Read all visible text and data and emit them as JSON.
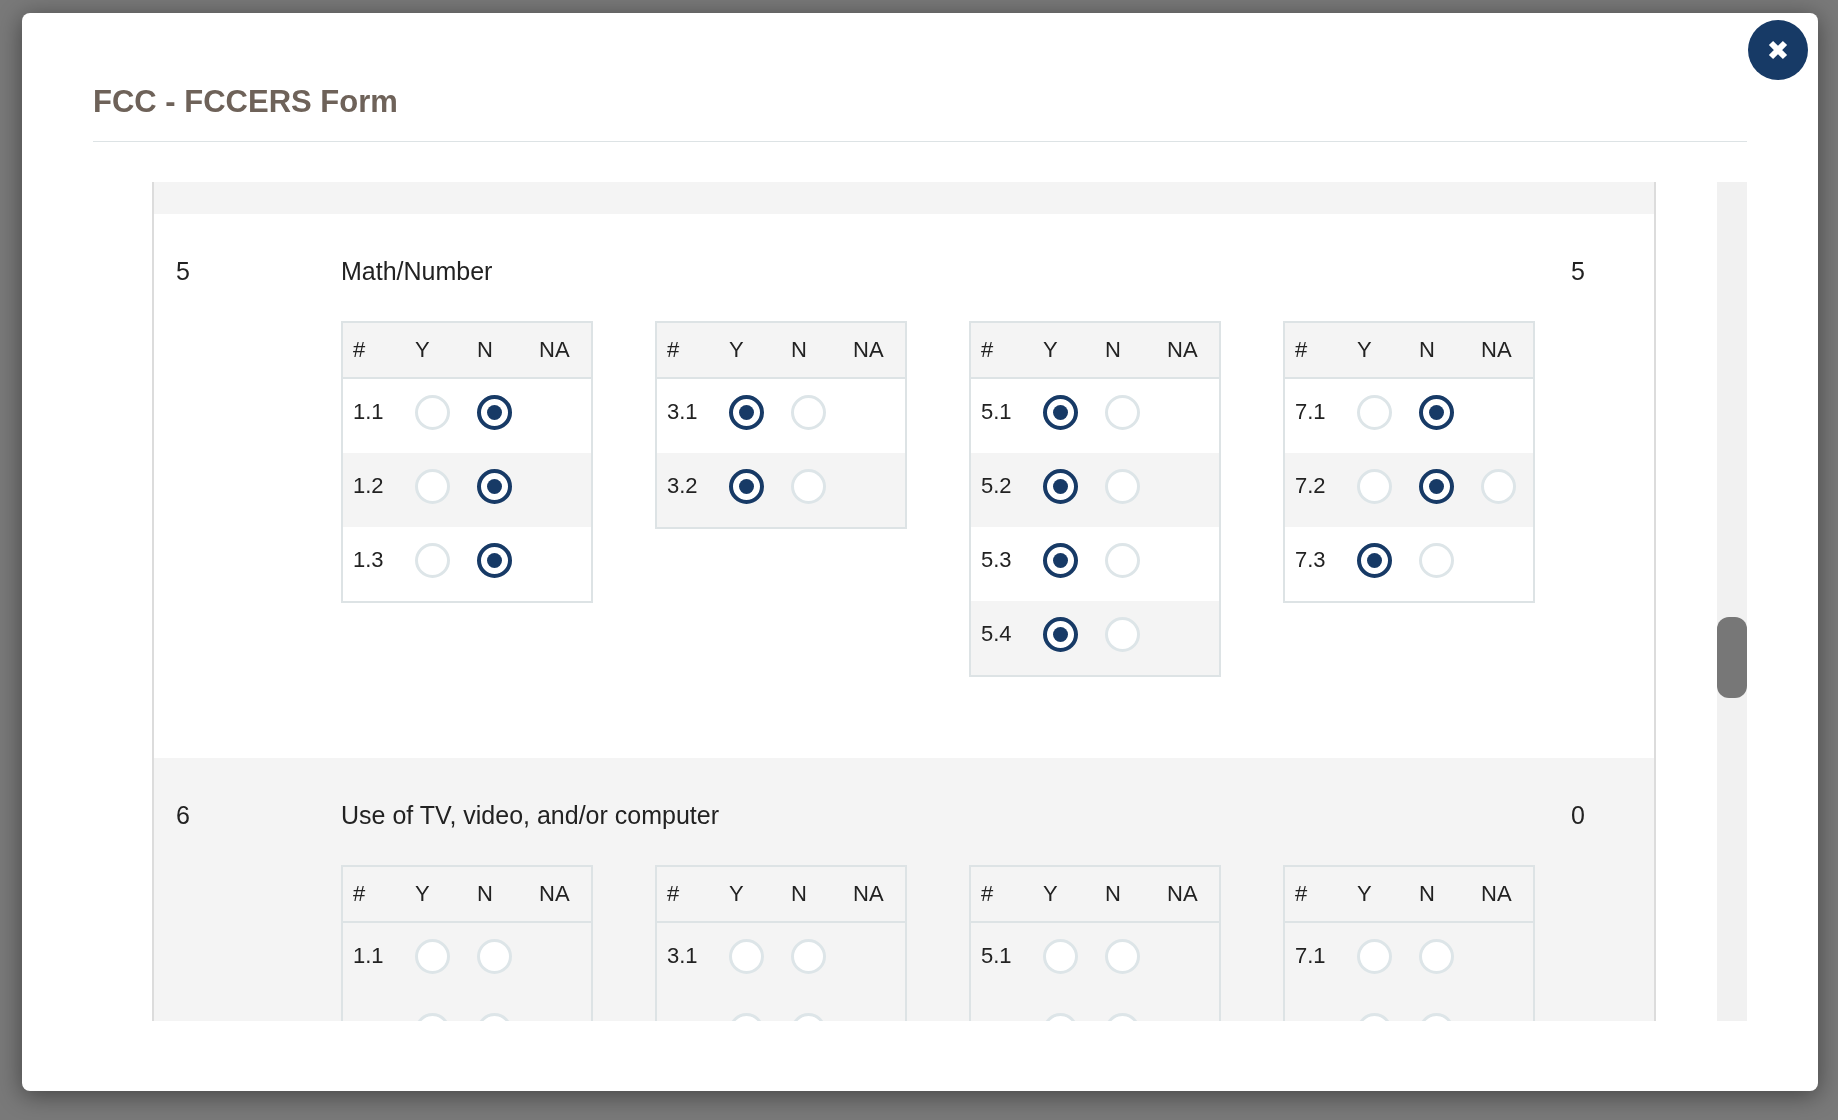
{
  "dialog": {
    "title": "FCC - FCCERS Form"
  },
  "items": [
    {
      "number": "5",
      "title": "Math/Number",
      "score": "5",
      "groups": [
        {
          "columns": [
            "#",
            "Y",
            "N",
            "NA"
          ],
          "rows": [
            {
              "number": "1.1",
              "options": [
                {
                  "selected": false
                },
                {
                  "selected": true
                }
              ]
            },
            {
              "number": "1.2",
              "options": [
                {
                  "selected": false
                },
                {
                  "selected": true
                }
              ]
            },
            {
              "number": "1.3",
              "options": [
                {
                  "selected": false
                },
                {
                  "selected": true
                }
              ]
            }
          ]
        },
        {
          "columns": [
            "#",
            "Y",
            "N",
            "NA"
          ],
          "rows": [
            {
              "number": "3.1",
              "options": [
                {
                  "selected": true
                },
                {
                  "selected": false
                }
              ]
            },
            {
              "number": "3.2",
              "options": [
                {
                  "selected": true
                },
                {
                  "selected": false
                }
              ]
            }
          ]
        },
        {
          "columns": [
            "#",
            "Y",
            "N",
            "NA"
          ],
          "rows": [
            {
              "number": "5.1",
              "options": [
                {
                  "selected": true
                },
                {
                  "selected": false
                }
              ]
            },
            {
              "number": "5.2",
              "options": [
                {
                  "selected": true
                },
                {
                  "selected": false
                }
              ]
            },
            {
              "number": "5.3",
              "options": [
                {
                  "selected": true
                },
                {
                  "selected": false
                }
              ]
            },
            {
              "number": "5.4",
              "options": [
                {
                  "selected": true
                },
                {
                  "selected": false
                }
              ]
            }
          ]
        },
        {
          "columns": [
            "#",
            "Y",
            "N",
            "NA"
          ],
          "rows": [
            {
              "number": "7.1",
              "options": [
                {
                  "selected": false
                },
                {
                  "selected": true
                }
              ]
            },
            {
              "number": "7.2",
              "options": [
                {
                  "selected": false
                },
                {
                  "selected": true
                },
                {
                  "selected": false
                }
              ]
            },
            {
              "number": "7.3",
              "options": [
                {
                  "selected": true
                },
                {
                  "selected": false
                }
              ]
            }
          ]
        }
      ]
    },
    {
      "number": "6",
      "title": "Use of TV, video, and/or computer",
      "score": "0",
      "groups": [
        {
          "columns": [
            "#",
            "Y",
            "N",
            "NA"
          ],
          "rows": [
            {
              "number": "1.1",
              "options": [
                {
                  "selected": false
                },
                {
                  "selected": false
                }
              ]
            },
            {
              "options": [
                {
                  "selected": false
                },
                {
                  "selected": false
                }
              ]
            }
          ]
        },
        {
          "columns": [
            "#",
            "Y",
            "N",
            "NA"
          ],
          "rows": [
            {
              "number": "3.1",
              "options": [
                {
                  "selected": false
                },
                {
                  "selected": false
                }
              ]
            },
            {
              "options": [
                {
                  "selected": false
                },
                {
                  "selected": false
                }
              ]
            }
          ]
        },
        {
          "columns": [
            "#",
            "Y",
            "N",
            "NA"
          ],
          "rows": [
            {
              "number": "5.1",
              "options": [
                {
                  "selected": false
                },
                {
                  "selected": false
                }
              ]
            },
            {
              "options": [
                {
                  "selected": false
                },
                {
                  "selected": false
                }
              ]
            }
          ]
        },
        {
          "columns": [
            "#",
            "Y",
            "N",
            "NA"
          ],
          "rows": [
            {
              "number": "7.1",
              "options": [
                {
                  "selected": false
                },
                {
                  "selected": false
                }
              ]
            },
            {
              "options": [
                {
                  "selected": false
                },
                {
                  "selected": false
                }
              ]
            }
          ]
        }
      ]
    }
  ]
}
